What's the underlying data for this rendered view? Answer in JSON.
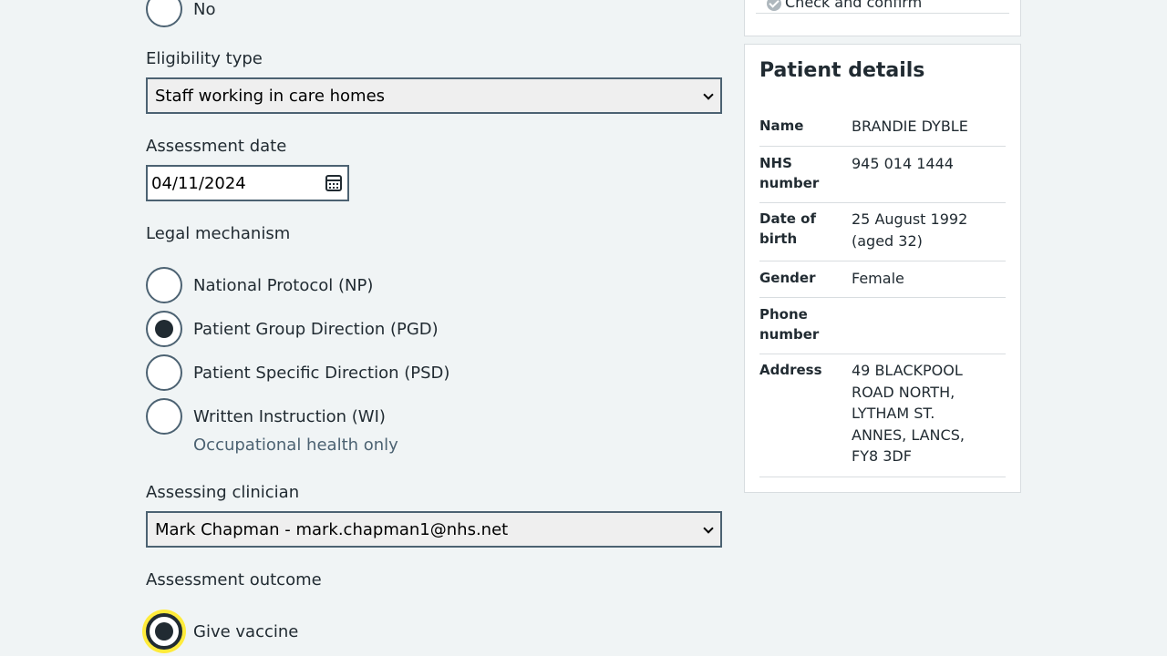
{
  "form": {
    "previous_option": "No",
    "eligibility": {
      "label": "Eligibility type",
      "value": "Staff working in care homes"
    },
    "assessment_date": {
      "label": "Assessment date",
      "value": "04/11/2024"
    },
    "legal_mechanism": {
      "label": "Legal mechanism",
      "options": [
        {
          "label": "National Protocol (NP)",
          "checked": false
        },
        {
          "label": "Patient Group Direction (PGD)",
          "checked": true
        },
        {
          "label": "Patient Specific Direction (PSD)",
          "checked": false
        },
        {
          "label": "Written Instruction (WI)",
          "checked": false,
          "hint": "Occupational health only"
        }
      ]
    },
    "clinician": {
      "label": "Assessing clinician",
      "value": "Mark Chapman - mark.chapman1@nhs.net"
    },
    "outcome": {
      "label": "Assessment outcome",
      "first_option": "Give vaccine"
    }
  },
  "task_list": {
    "last_item": "Check and confirm",
    "status_icon": "tick-circle-icon"
  },
  "patient": {
    "title": "Patient details",
    "rows": [
      {
        "key": "Name",
        "value": "BRANDIE DYBLE"
      },
      {
        "key": "NHS number",
        "value": "945 014 1444"
      },
      {
        "key": "Date of birth",
        "value": "25 August 1992 (aged 32)"
      },
      {
        "key": "Gender",
        "value": "Female"
      },
      {
        "key": "Phone number",
        "value": ""
      },
      {
        "key": "Address",
        "value": "49 BLACKPOOL ROAD NORTH, LYTHAM ST. ANNES, LANCS, FY8 3DF"
      }
    ]
  },
  "colors": {
    "focus": "#ffeb3b",
    "text": "#212b32",
    "border": "#4c6272",
    "background": "#f0f4f5"
  }
}
